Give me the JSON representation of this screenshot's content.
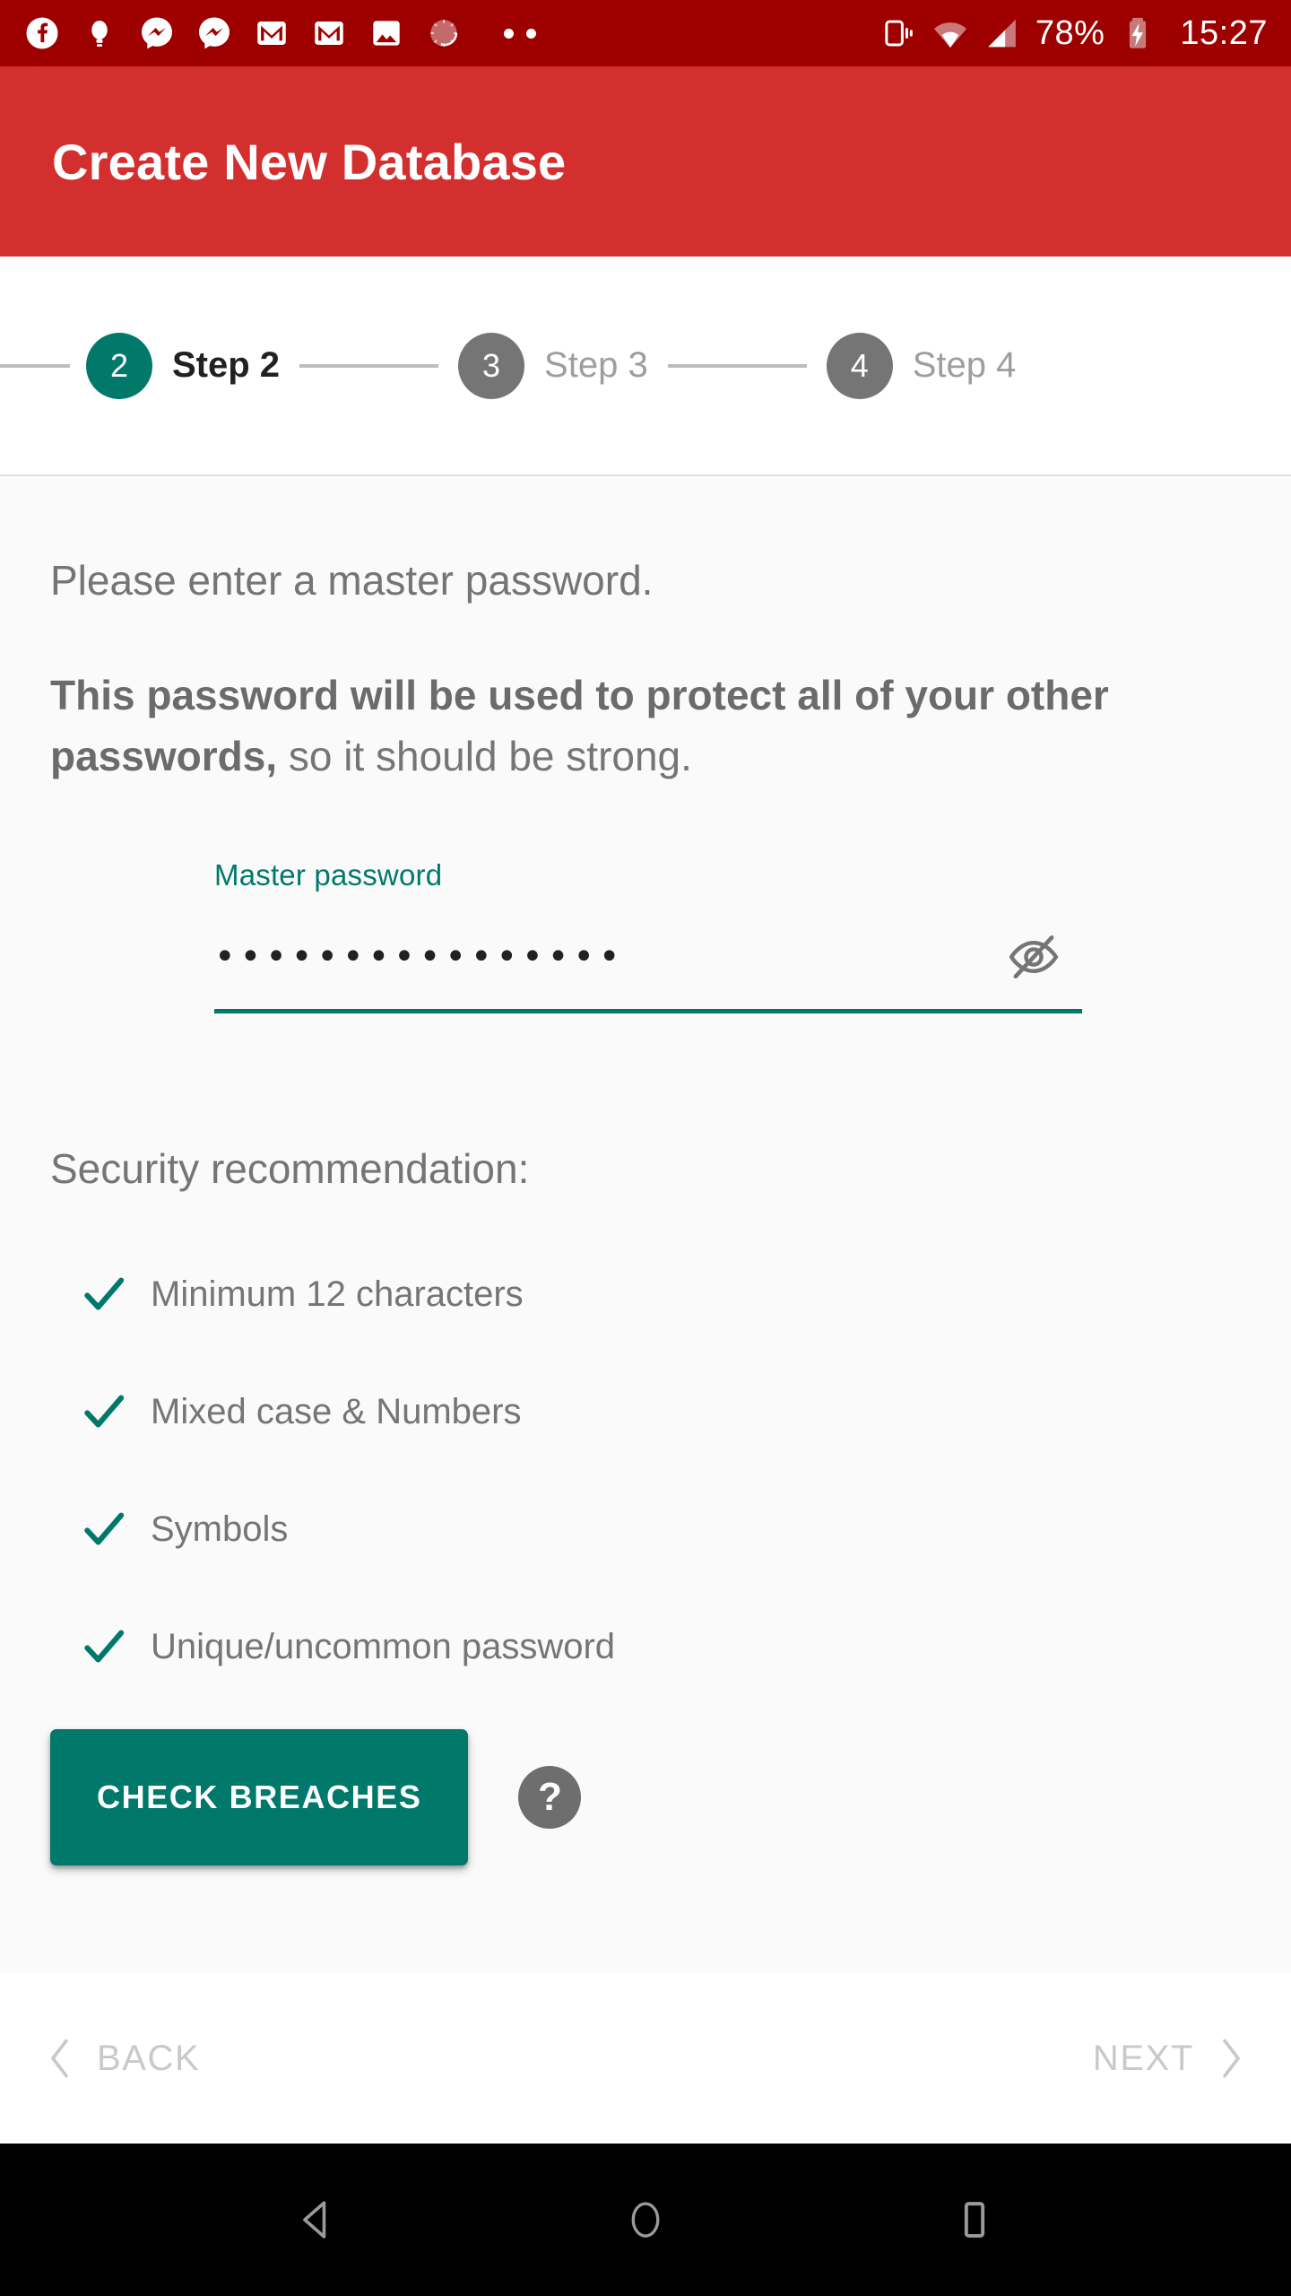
{
  "status_bar": {
    "background_color": "#9E0000",
    "notification_icons": [
      "facebook-icon",
      "bulb-icon",
      "messenger-icon",
      "messenger-icon",
      "gmail-icon",
      "gmail-icon",
      "photos-icon",
      "clock-icon",
      "more-dots-icon"
    ],
    "vibrate_icon": "vibrate-icon",
    "wifi_icon": "wifi-icon",
    "signal_icon": "cell-signal-icon",
    "battery_percent": "78%",
    "battery_icon": "battery-charging-icon",
    "clock": "15:27"
  },
  "toolbar": {
    "title": "Create New Database",
    "background_color": "#D32F2F"
  },
  "stepper": {
    "active_color": "#00796B",
    "inactive_color": "#757575",
    "steps": [
      {
        "number": "2",
        "label": "Step 2",
        "state": "active"
      },
      {
        "number": "3",
        "label": "Step 3",
        "state": "inactive"
      },
      {
        "number": "4",
        "label": "Step 4",
        "state": "inactive"
      }
    ]
  },
  "content": {
    "intro": "Please enter a master password.",
    "warning_bold": "This password will be used to protect all of your other passwords,",
    "warning_rest": " so it should be strong.",
    "password_field": {
      "label": "Master password",
      "value": "••••••••••••••••",
      "placeholder": "Master password",
      "toggle_icon": "eye-off-icon",
      "underline_color": "#00796B"
    },
    "recommendation_title": "Security recommendation:",
    "recommendations": [
      {
        "label": "Minimum 12 characters",
        "icon": "check-icon",
        "checked": true
      },
      {
        "label": "Mixed case & Numbers",
        "icon": "check-icon",
        "checked": true
      },
      {
        "label": "Symbols",
        "icon": "check-icon",
        "checked": true
      },
      {
        "label": "Unique/uncommon password",
        "icon": "check-icon",
        "checked": true
      }
    ],
    "check_breaches_label": "CHECK BREACHES",
    "help_label": "?"
  },
  "footer": {
    "back_label": "BACK",
    "next_label": "NEXT",
    "back_icon": "chevron-left-icon",
    "next_icon": "chevron-right-icon"
  },
  "navigation_bar": {
    "back_icon": "android-back-icon",
    "home_icon": "android-home-icon",
    "recents_icon": "android-recents-icon"
  }
}
